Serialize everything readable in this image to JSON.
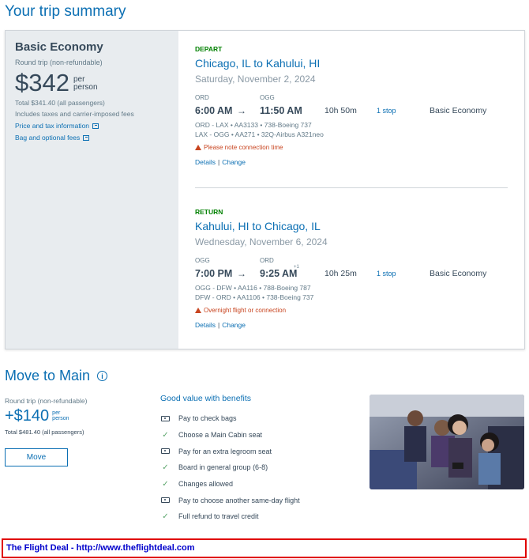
{
  "page_title": "Your trip summary",
  "fare": {
    "name": "Basic Economy",
    "trip_type": "Round trip (non-refundable)",
    "price": "$342",
    "per_line1": "per",
    "per_line2": "person",
    "total": "Total $341.40 (all passengers)",
    "fees_note": "Includes taxes and carrier-imposed fees",
    "price_tax_link": "Price and tax information",
    "bag_fees_link": "Bag and optional fees"
  },
  "depart": {
    "label": "DEPART",
    "route": "Chicago, IL to Kahului, HI",
    "date": "Saturday, November 2, 2024",
    "origin_code": "ORD",
    "dest_code": "OGG",
    "dep_time": "6:00 AM",
    "arr_time": "11:50 AM",
    "arr_day_offset": "",
    "duration": "10h 50m",
    "stops": "1 stop",
    "cabin": "Basic Economy",
    "legs": [
      "ORD - LAX • AA3133 • 738-Boeing 737",
      "LAX - OGG • AA271 • 32Q-Airbus A321neo"
    ],
    "warning": "Please note connection time",
    "details_link": "Details",
    "change_link": "Change"
  },
  "return": {
    "label": "RETURN",
    "route": "Kahului, HI to Chicago, IL",
    "date": "Wednesday, November 6, 2024",
    "origin_code": "OGG",
    "dest_code": "ORD",
    "dep_time": "7:00 PM",
    "arr_time": "9:25 AM",
    "arr_day_offset": "+1",
    "duration": "10h 25m",
    "stops": "1 stop",
    "cabin": "Basic Economy",
    "legs": [
      "OGG - DFW • AA116 • 788-Boeing 787",
      "DFW - ORD • AA1106 • 738-Boeing 737"
    ],
    "warning": "Overnight flight or connection",
    "details_link": "Details",
    "change_link": "Change"
  },
  "upsell": {
    "title": "Move to Main",
    "trip_type": "Round trip (non-refundable)",
    "price": "+$140",
    "per_line1": "per",
    "per_line2": "person",
    "total": "Total $481.40 (all passengers)",
    "button_label": "Move",
    "benefits_title": "Good value with benefits",
    "benefits": [
      {
        "icon": "money-icon",
        "text": "Pay to check bags"
      },
      {
        "icon": "check-icon",
        "text": "Choose a Main Cabin seat"
      },
      {
        "icon": "money-icon",
        "text": "Pay for an extra legroom seat"
      },
      {
        "icon": "check-icon",
        "text": "Board in general group (6-8)"
      },
      {
        "icon": "check-icon",
        "text": "Changes allowed"
      },
      {
        "icon": "money-icon",
        "text": "Pay to choose another same-day flight"
      },
      {
        "icon": "check-icon",
        "text": "Full refund to travel credit"
      }
    ]
  },
  "footer": {
    "text": "The Flight Deal - http://www.theflightdeal.com"
  },
  "colors": {
    "brand_blue": "#0b6fb3",
    "depart_green": "#008000",
    "warning_orange": "#c8441f",
    "footer_red": "#e00000"
  }
}
